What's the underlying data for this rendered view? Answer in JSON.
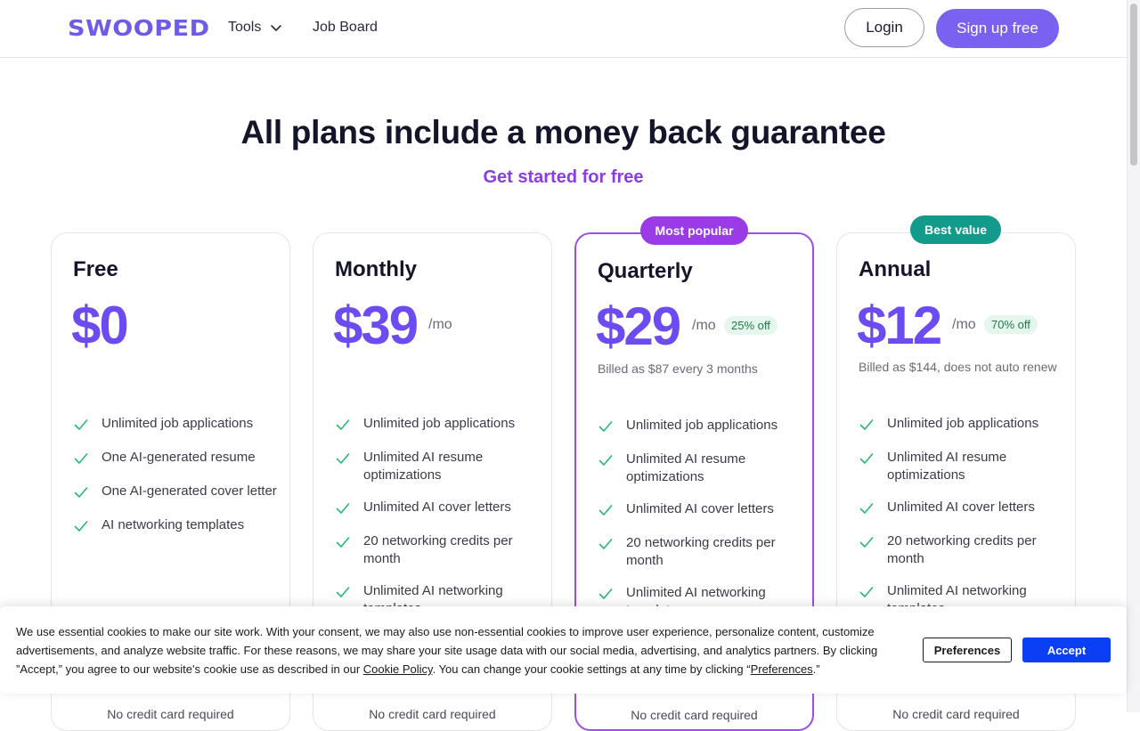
{
  "header": {
    "logo": "SWOOPED",
    "nav": {
      "tools": "Tools",
      "job_board": "Job Board"
    },
    "login": "Login",
    "signup": "Sign up free"
  },
  "hero": {
    "title": "All plans include a money back guarantee",
    "subtitle": "Get started for free"
  },
  "plans": [
    {
      "name": "Free",
      "price": "$0",
      "per": "",
      "discount": "",
      "billed": "",
      "badge": "",
      "features": [
        "Unlimited job applications",
        "One AI-generated resume",
        "One AI-generated cover letter",
        "AI networking templates"
      ],
      "footer": "No credit card required"
    },
    {
      "name": "Monthly",
      "price": "$39",
      "per": "/mo",
      "discount": "",
      "billed": "",
      "badge": "",
      "features": [
        "Unlimited job applications",
        "Unlimited AI resume optimizations",
        "Unlimited AI cover letters",
        "20 networking credits per month",
        "Unlimited AI networking templates"
      ],
      "footer": "No credit card required"
    },
    {
      "name": "Quarterly",
      "price": "$29",
      "per": "/mo",
      "discount": "25% off",
      "billed": "Billed as $87 every 3 months",
      "badge": "Most popular",
      "features": [
        "Unlimited job applications",
        "Unlimited AI resume optimizations",
        "Unlimited AI cover letters",
        "20 networking credits per month",
        "Unlimited AI networking templates"
      ],
      "footer": "No credit card required"
    },
    {
      "name": "Annual",
      "price": "$12",
      "per": "/mo",
      "discount": "70% off",
      "billed": "Billed as $144, does not auto renew",
      "badge": "Best value",
      "features": [
        "Unlimited job applications",
        "Unlimited AI resume optimizations",
        "Unlimited AI cover letters",
        "20 networking credits per month",
        "Unlimited AI networking templates"
      ],
      "footer": "No credit card required"
    }
  ],
  "cookie": {
    "text_1": "We use essential cookies to make our site work. With your consent, we may also use non-essential cookies to improve user experience, personalize content, customize advertisements, and analyze website traffic. For these reasons, we may share your site usage data with our social media, advertising, and analytics partners. By clicking ”Accept,” you agree to our website's cookie use as described in our ",
    "link_policy": "Cookie Policy",
    "text_2": ". You can change your cookie settings at any time by clicking “",
    "link_prefs": "Preferences",
    "text_3": ".”",
    "preferences_button": "Preferences",
    "accept_button": "Accept"
  },
  "colors": {
    "brand": "#6c5ce7",
    "price": "#6c4cf0",
    "subtitle": "#8a3de6",
    "badge_popular": "#9b3be8",
    "badge_value": "#129a8a",
    "check": "#2bb673",
    "accept": "#0a3ff5"
  },
  "icons": {
    "tools_chevron": "chevron-down-icon",
    "feature_check": "check-icon"
  }
}
